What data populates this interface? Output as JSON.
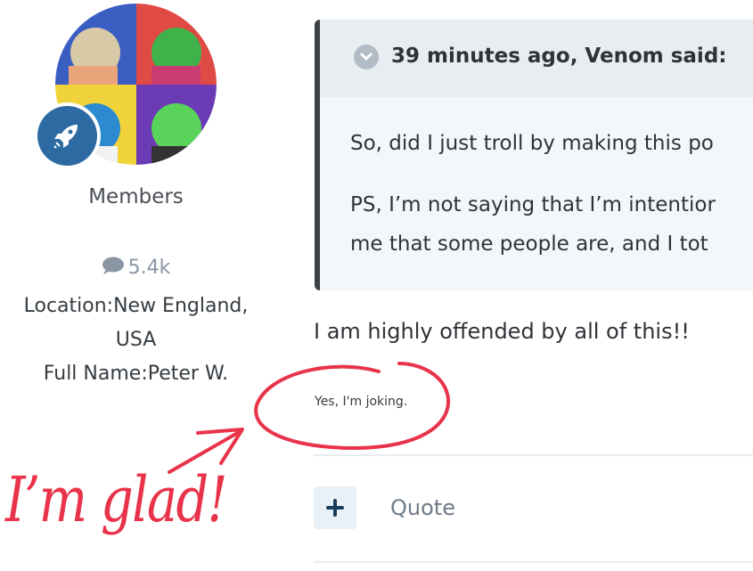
{
  "author": {
    "group": "Members",
    "post_count": "5.4k",
    "location_label": "Location:",
    "location_value_line1": "New England,",
    "location_value_line2": "USA",
    "fullname_label": "Full Name:",
    "fullname_value": "Peter W."
  },
  "quote": {
    "citation": "39 minutes ago, Venom said:",
    "para1": "So, did I just troll by making this po",
    "para2_line1": "PS, I’m not saying that I’m intentior",
    "para2_line2": "me that some people are, and I tot"
  },
  "post": {
    "reply": "I am highly offended by all of this!!",
    "small_note": "Yes, I'm joking."
  },
  "actions": {
    "quote_label": "Quote"
  },
  "annotation": {
    "text": "I’m glad!",
    "color": "#e8334a"
  },
  "colors": {
    "badge": "#2d6aa1",
    "quote_border": "#3d4247",
    "quote_header": "#e8edf2",
    "quote_bg": "#f3f6fa"
  }
}
